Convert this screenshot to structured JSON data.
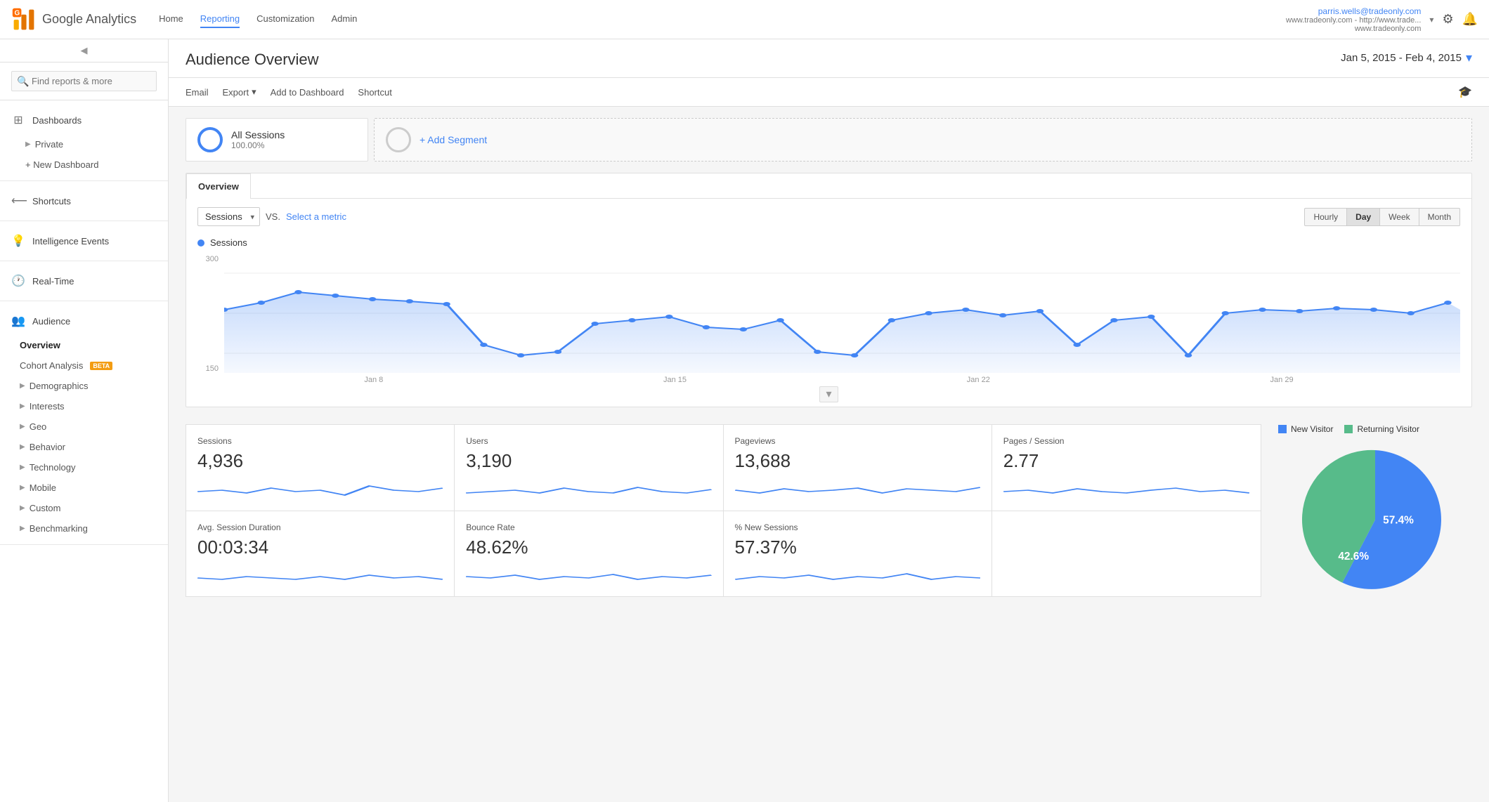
{
  "app": {
    "logo_text": "Google Analytics"
  },
  "topnav": {
    "links": [
      {
        "label": "Home",
        "active": false
      },
      {
        "label": "Reporting",
        "active": true
      },
      {
        "label": "Customization",
        "active": false
      },
      {
        "label": "Admin",
        "active": false
      }
    ],
    "user": {
      "email": "parris.wells@tradeonly.com",
      "site1": "www.tradeonly.com - http://www.trade...",
      "site2": "www.tradeonly.com"
    }
  },
  "sidebar": {
    "search_placeholder": "Find reports & more",
    "sections": {
      "dashboards_label": "Dashboards",
      "private_label": "Private",
      "new_dashboard_label": "+ New Dashboard",
      "shortcuts_label": "Shortcuts",
      "intelligence_label": "Intelligence Events",
      "realtime_label": "Real-Time",
      "audience_label": "Audience"
    },
    "audience_sub": [
      {
        "label": "Overview",
        "active": true,
        "indent": false
      },
      {
        "label": "Cohort Analysis",
        "badge": "BETA",
        "indent": false
      },
      {
        "label": "Demographics",
        "tri": true,
        "indent": false
      },
      {
        "label": "Interests",
        "tri": true,
        "indent": false
      },
      {
        "label": "Geo",
        "tri": true,
        "indent": false
      },
      {
        "label": "Behavior",
        "tri": true,
        "indent": false
      },
      {
        "label": "Technology",
        "tri": true,
        "indent": false
      },
      {
        "label": "Mobile",
        "tri": true,
        "indent": false
      },
      {
        "label": "Custom",
        "tri": true,
        "indent": false
      },
      {
        "label": "Benchmarking",
        "tri": true,
        "indent": false
      }
    ]
  },
  "content": {
    "page_title": "Audience Overview",
    "date_range": "Jan 5, 2015 - Feb 4, 2015",
    "toolbar": {
      "email": "Email",
      "export": "Export",
      "add_to_dashboard": "Add to Dashboard",
      "shortcut": "Shortcut"
    },
    "segment": {
      "name": "All Sessions",
      "pct": "100.00%",
      "add_label": "+ Add Segment"
    },
    "overview_tab": "Overview",
    "chart": {
      "metric_default": "Sessions",
      "vs_label": "VS.",
      "select_metric": "Select a metric",
      "legend_label": "Sessions",
      "y_max": "300",
      "y_mid": "150",
      "x_labels": [
        "Jan 8",
        "Jan 15",
        "Jan 22",
        "Jan 29"
      ],
      "time_buttons": [
        "Hourly",
        "Day",
        "Week",
        "Month"
      ],
      "active_time": "Day"
    },
    "metrics": [
      {
        "title": "Sessions",
        "value": "4,936"
      },
      {
        "title": "Users",
        "value": "3,190"
      },
      {
        "title": "Pageviews",
        "value": "13,688"
      },
      {
        "title": "Pages / Session",
        "value": "2.77"
      },
      {
        "title": "Avg. Session Duration",
        "value": "00:03:34"
      },
      {
        "title": "Bounce Rate",
        "value": "48.62%"
      },
      {
        "title": "% New Sessions",
        "value": "57.37%"
      }
    ],
    "pie": {
      "new_visitor_pct": "57.4%",
      "returning_visitor_pct": "42.6%",
      "new_visitor_label": "New Visitor",
      "returning_visitor_label": "Returning Visitor",
      "new_color": "#4285f4",
      "returning_color": "#57bb8a"
    }
  }
}
